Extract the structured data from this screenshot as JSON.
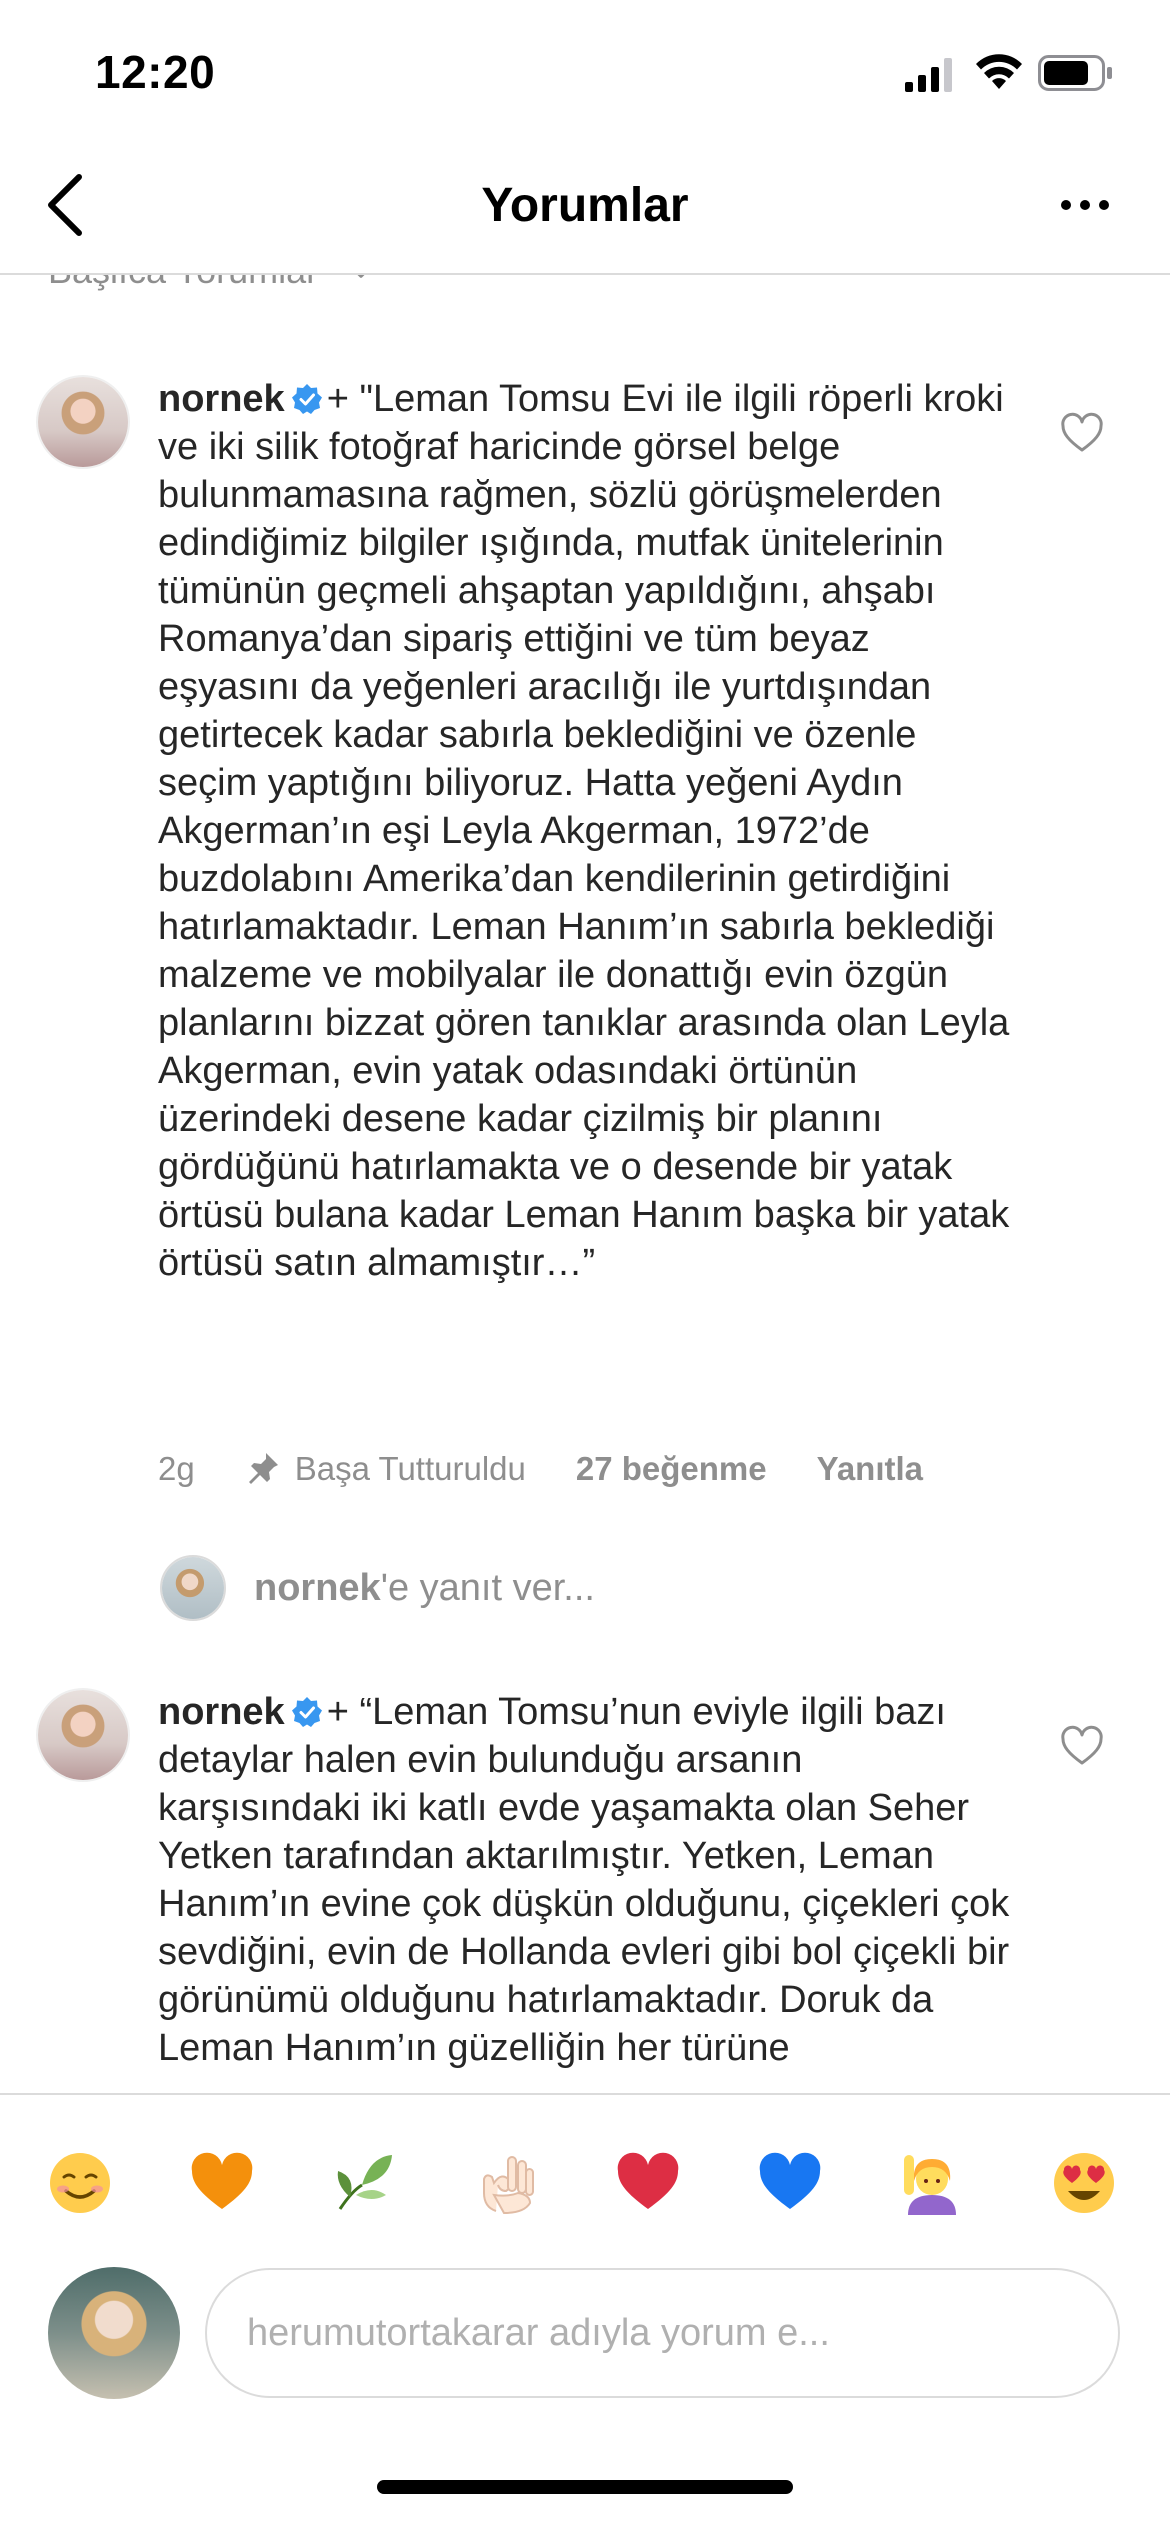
{
  "status_bar": {
    "time": "12:20"
  },
  "header": {
    "title": "Yorumlar"
  },
  "sort": {
    "label": "Başlıca Yorumlar"
  },
  "comments": [
    {
      "username": "nornek",
      "text": "+ \"Leman Tomsu Evi ile ilgili röperli kroki ve iki silik fotoğraf haricinde görsel belge bulunmamasına rağmen, sözlü görüşmelerden edindiğimiz bilgiler ışığında, mutfak ünitelerinin tümünün geçmeli ahşaptan yapıldığını, ahşabı Romanya’dan sipariş ettiğini ve tüm beyaz eşyasını da yeğenleri aracılığı ile yurtdışından getirtecek kadar sabırla beklediğini ve özenle seçim yaptığını biliyoruz. Hatta yeğeni Aydın Akgerman’ın eşi Leyla Akgerman, 1972’de buzdolabını Amerika’dan kendilerinin getirdiğini hatırlamaktadır. Leman Hanım’ın sabırla beklediği malzeme ve mobilyalar ile donattığı evin özgün planlarını bizzat gören tanıklar arasında olan Leyla Akgerman, evin yatak odasındaki örtünün üzerindeki desene kadar çizilmiş bir planını gördüğünü hatırlamakta ve o desende bir yatak örtüsü bulana kadar Leman Hanım başka bir yatak örtüsü satın almamıştır…”",
      "time": "2g",
      "pinned": "Başa Tutturuldu",
      "likes": "27 beğenme",
      "reply": "Yanıtla"
    },
    {
      "username": "nornek",
      "text": "+ “Leman Tomsu’nun eviyle ilgili bazı detaylar halen evin bulunduğu arsanın karşısındaki iki katlı evde yaşamakta olan Seher Yetken tarafından aktarılmıştır. Yetken, Leman Hanım’ın evine çok düşkün olduğunu, çiçekleri çok sevdiğini, evin de Hollanda evleri gibi bol çiçekli bir görünümü olduğunu hatırlamaktadır. Doruk da Leman Hanım’ın güzelliğin her türüne"
    }
  ],
  "reply_prompt": {
    "user": "nornek",
    "suffix": "'e yanıt ver..."
  },
  "emojis": [
    {
      "name": "smiling-face-emoji",
      "glyph": "☺"
    },
    {
      "name": "orange-heart-emoji",
      "glyph": "♥"
    },
    {
      "name": "herb-emoji",
      "glyph": "🌿"
    },
    {
      "name": "ok-hand-emoji",
      "glyph": "👌"
    },
    {
      "name": "red-heart-emoji",
      "glyph": "♥"
    },
    {
      "name": "blue-heart-emoji",
      "glyph": "♥"
    },
    {
      "name": "person-raising-hand-emoji",
      "glyph": "🙋"
    },
    {
      "name": "heart-eyes-emoji",
      "glyph": "😍"
    }
  ],
  "composer": {
    "placeholder": "herumutortakarar adıyla yorum e..."
  },
  "colors": {
    "verified": "#3897f0",
    "muted": "#8e8e8e",
    "divider": "#dbdbdb"
  }
}
